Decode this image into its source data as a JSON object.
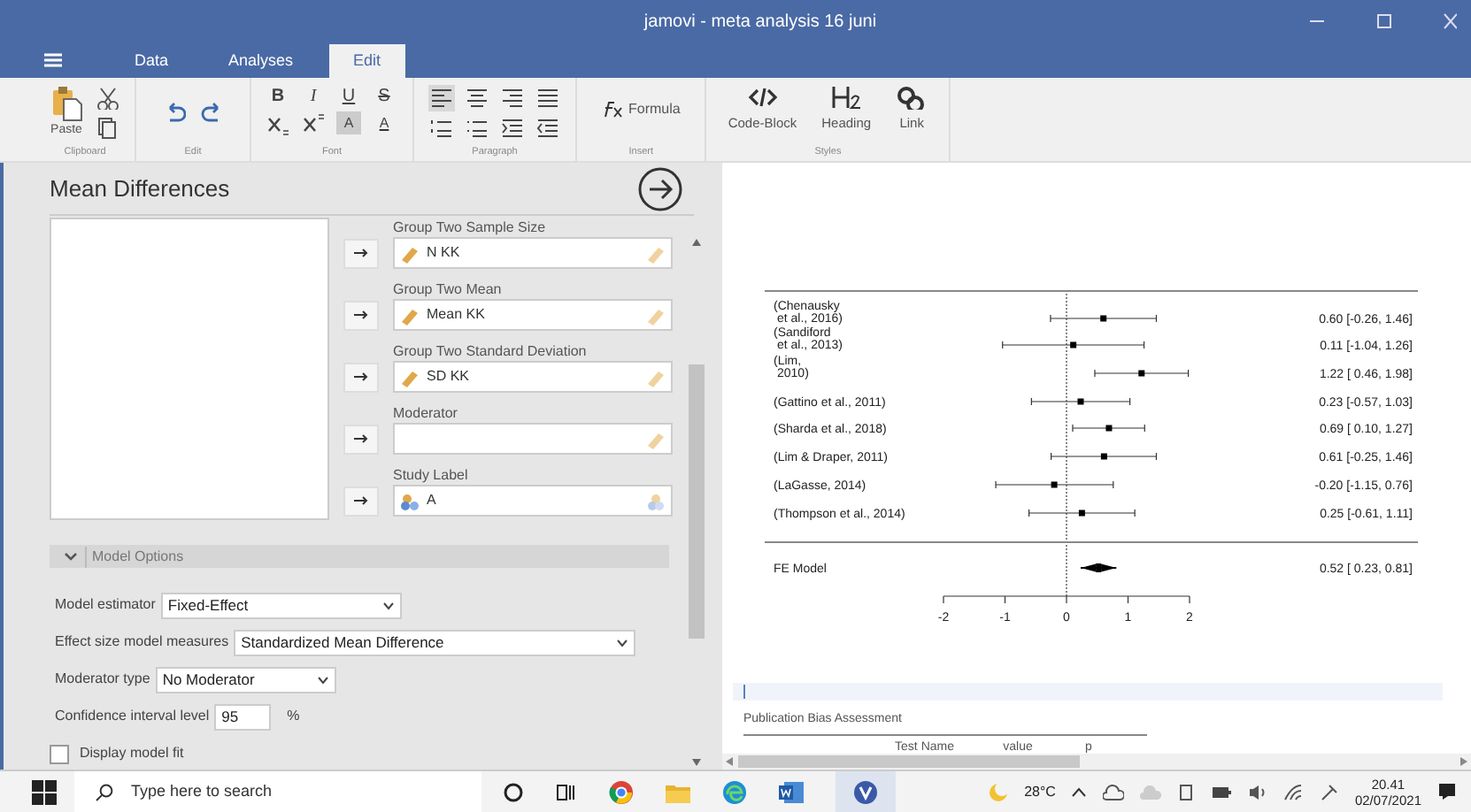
{
  "window": {
    "title": "jamovi - meta analysis 16 juni"
  },
  "tabs": [
    {
      "label": "Data",
      "selected": false
    },
    {
      "label": "Analyses",
      "selected": false
    },
    {
      "label": "Edit",
      "selected": true
    }
  ],
  "ribbon": {
    "groups": [
      {
        "label": "Clipboard",
        "items": [
          {
            "kind": "paste",
            "label": "Paste"
          },
          {
            "kind": "cut"
          },
          {
            "kind": "copy"
          }
        ]
      },
      {
        "label": "Edit",
        "items": [
          {
            "kind": "undo"
          },
          {
            "kind": "redo"
          }
        ]
      },
      {
        "label": "Font",
        "items": [
          {
            "kind": "bold",
            "label": "B"
          },
          {
            "kind": "italic",
            "label": "I"
          },
          {
            "kind": "underline",
            "label": "U"
          },
          {
            "kind": "strike",
            "label": "S"
          },
          {
            "kind": "sub"
          },
          {
            "kind": "sup"
          },
          {
            "kind": "highlight",
            "label": "A"
          },
          {
            "kind": "color",
            "label": "A"
          }
        ]
      },
      {
        "label": "Paragraph",
        "items": [
          {
            "kind": "align-left",
            "selected": true
          },
          {
            "kind": "align-center",
            "selected": false
          },
          {
            "kind": "align-right",
            "selected": false
          },
          {
            "kind": "justify",
            "selected": false
          },
          {
            "kind": "ordered-list"
          },
          {
            "kind": "bullet-list"
          },
          {
            "kind": "indent"
          },
          {
            "kind": "outdent"
          }
        ]
      },
      {
        "label": "Insert",
        "items": [
          {
            "kind": "formula",
            "label": "Formula"
          }
        ]
      },
      {
        "label": "Styles",
        "items": [
          {
            "kind": "code",
            "label": "Code-Block"
          },
          {
            "kind": "heading",
            "label": "Heading"
          },
          {
            "kind": "link",
            "label": "Link"
          }
        ]
      }
    ]
  },
  "analysis": {
    "title": "Mean Differences",
    "targets": [
      {
        "label": "Group Two Sample Size",
        "value": "N KK",
        "kind": "continuous"
      },
      {
        "label": "Group Two Mean",
        "value": "Mean KK",
        "kind": "continuous"
      },
      {
        "label": "Group Two Standard Deviation",
        "value": "SD KK",
        "kind": "continuous"
      },
      {
        "label": "Moderator",
        "kind": "continuous"
      },
      {
        "label": "Study Label",
        "value": "A",
        "kind": "nominal"
      }
    ],
    "section": {
      "label": "Model Options",
      "expanded": true
    },
    "options": [
      {
        "kind": "select",
        "label": "Model estimator",
        "value": "Fixed-Effect"
      },
      {
        "kind": "select",
        "label": "Effect size model measures",
        "value": "Standardized Mean Difference"
      },
      {
        "kind": "select",
        "label": "Moderator type",
        "value": "No Moderator"
      },
      {
        "kind": "number",
        "label": "Confidence interval level",
        "value": "95",
        "unit": "%"
      },
      {
        "kind": "checkbox",
        "label": "Display model fit",
        "checked": false
      }
    ]
  },
  "results": {
    "forest_plot": {
      "chart_data": {
        "type": "scatter",
        "orientation": "horizontal",
        "categories": [
          "(Chenausky\n et al., 2016)",
          "(Sandiford\n et al., 2013)",
          "(Lim,\n 2010)",
          "(Gattino et al., 2011)",
          "(Sharda et al., 2018)",
          "(Lim & Draper, 2011)",
          "(LaGasse, 2014)",
          "(Thompson et al., 2014)",
          "FE Model"
        ],
        "series": [
          {
            "values": [
              0.6,
              0.11,
              1.22,
              0.23,
              0.69,
              0.61,
              -0.2,
              0.25,
              null
            ],
            "errors": [
              [
                -0.26,
                1.46
              ],
              [
                -1.04,
                1.26
              ],
              [
                0.46,
                1.98
              ],
              [
                -0.57,
                1.03
              ],
              [
                0.1,
                1.27
              ],
              [
                -0.25,
                1.46
              ],
              [
                -1.15,
                0.76
              ],
              [
                -0.61,
                1.11
              ],
              null
            ]
          },
          {
            "values": [
              null,
              null,
              null,
              null,
              null,
              null,
              null,
              null,
              0.52
            ],
            "errors": [
              null,
              null,
              null,
              null,
              null,
              null,
              null,
              null,
              [
                0.23,
                0.81
              ]
            ]
          }
        ],
        "value_labels": [
          "0.60 [-0.26, 1.46]",
          "0.11 [-1.04, 1.26]",
          "1.22 [ 0.46, 1.98]",
          "0.23 [-0.57, 1.03]",
          "0.69 [ 0.10, 1.27]",
          "0.61 [-0.25, 1.46]",
          "-0.20 [-1.15, 0.76]",
          "0.25 [-0.61, 1.11]",
          "0.52 [ 0.23, 0.81]"
        ],
        "xlim": [
          -2,
          2
        ],
        "xticks": [
          -2,
          -1,
          0,
          1,
          2
        ]
      }
    },
    "table": {
      "title": "Publication Bias Assessment",
      "columns": [
        "Test Name",
        "value",
        "p"
      ]
    }
  },
  "taskbar": {
    "search_placeholder": "Type here to search",
    "weather": "28°C",
    "time": "20.41",
    "date": "02/07/2021"
  }
}
